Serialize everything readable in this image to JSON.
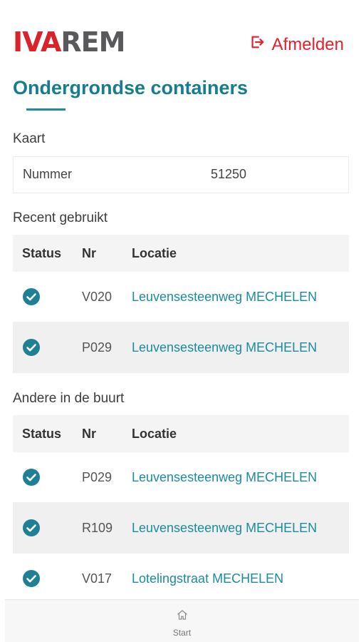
{
  "brand": {
    "logo_part1": "IVA",
    "logo_part2": "REM",
    "red": "#d8232a",
    "grey": "#59595b"
  },
  "header": {
    "logout_label": "Afmelden",
    "logout_icon": "sign-out-icon",
    "logout_color": "#e4202c"
  },
  "page": {
    "title": "Ondergrondse containers"
  },
  "card": {
    "section_label": "Kaart",
    "number_label": "Nummer",
    "number_value": "51250"
  },
  "recent": {
    "section_label": "Recent gebruikt",
    "columns": [
      "Status",
      "Nr",
      "Locatie"
    ],
    "rows": [
      {
        "status": "check-circle-icon",
        "nr": "V020",
        "location": "Leuvensesteenweg MECHELEN"
      },
      {
        "status": "check-circle-icon",
        "nr": "P029",
        "location": "Leuvensesteenweg MECHELEN"
      }
    ]
  },
  "nearby": {
    "section_label": "Andere in de buurt",
    "columns": [
      "Status",
      "Nr",
      "Locatie"
    ],
    "rows": [
      {
        "status": "check-circle-icon",
        "nr": "P029",
        "location": "Leuvensesteenweg MECHELEN"
      },
      {
        "status": "check-circle-icon",
        "nr": "R109",
        "location": "Leuvensesteenweg MECHELEN"
      },
      {
        "status": "check-circle-icon",
        "nr": "V017",
        "location": "Lotelingstraat MECHELEN"
      }
    ]
  },
  "bottom_nav": {
    "items": [
      {
        "label": "Start",
        "icon": "home-icon"
      }
    ]
  },
  "colors": {
    "accent": "#177c8c",
    "link": "#1b8ca0",
    "status_ok": "#1f7f95"
  }
}
